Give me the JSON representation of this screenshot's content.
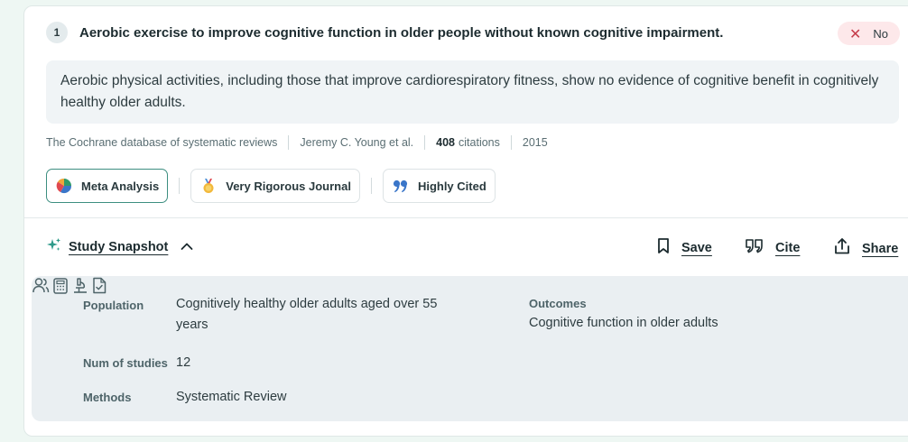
{
  "result": {
    "index": "1",
    "title": "Aerobic exercise to improve cognitive function in older people without known cognitive impairment.",
    "answer_badge": {
      "icon": "close-icon",
      "label": "No",
      "color": "#c63c4a"
    },
    "summary": "Aerobic physical activities, including those that improve cardiorespiratory fitness, show no evidence of cognitive benefit in cognitively healthy older adults.",
    "journal": "The Cochrane database of systematic reviews",
    "authors": "Jeremy C. Young et al.",
    "citations_count": "408",
    "citations_label": "citations",
    "year": "2015",
    "tags": [
      {
        "label": "Meta Analysis",
        "icon": "pie-chart-icon"
      },
      {
        "label": "Very Rigorous Journal",
        "icon": "medal-icon"
      },
      {
        "label": "Highly Cited",
        "icon": "quote-icon"
      }
    ]
  },
  "snapshot": {
    "toggle_label": "Study Snapshot",
    "actions": {
      "save": "Save",
      "cite": "Cite",
      "share": "Share"
    },
    "population_label": "Population",
    "population_value": "Cognitively healthy older adults aged over 55 years",
    "num_studies_label": "Num of studies",
    "num_studies_value": "12",
    "methods_label": "Methods",
    "methods_value": "Systematic Review",
    "outcomes_label": "Outcomes",
    "outcomes_value": "Cognitive function in older adults"
  },
  "colors": {
    "accent": "#3d8e80",
    "page_bg": "#eef7f3",
    "panel_bg": "#eaeff2"
  }
}
